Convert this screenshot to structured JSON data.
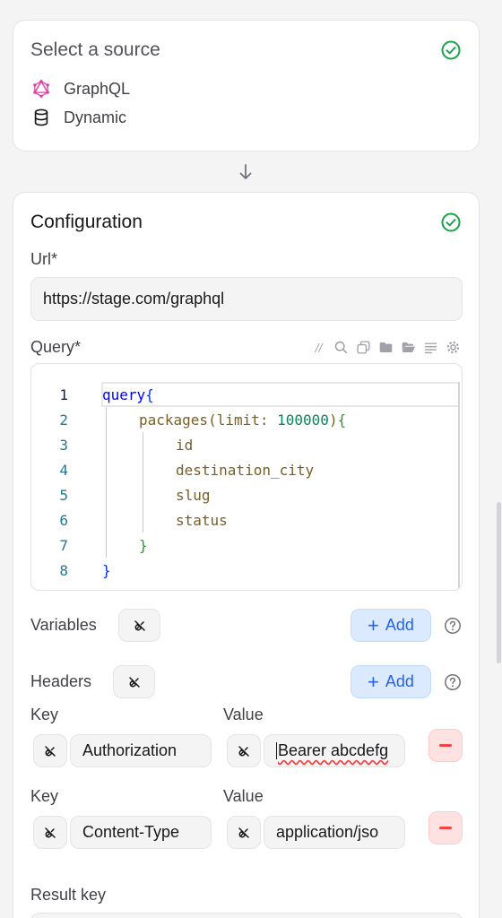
{
  "source_card": {
    "title": "Select a source",
    "options": [
      {
        "icon": "graphql-icon",
        "label": "GraphQL"
      },
      {
        "icon": "database-icon",
        "label": "Dynamic"
      }
    ]
  },
  "configuration": {
    "title": "Configuration",
    "url": {
      "label": "Url",
      "required": "*",
      "value": "https://stage.com/graphql"
    },
    "query": {
      "label": "Query",
      "required": "*",
      "toolbar_icons": [
        "comment-icon",
        "search-icon",
        "copy-icon",
        "folder-icon",
        "folder-open-icon",
        "format-icon",
        "settings-icon"
      ],
      "comment_glyph": "//",
      "lines": [
        {
          "num": "1",
          "parts": [
            "query",
            "{"
          ]
        },
        {
          "num": "2",
          "parts": [
            "packages",
            "(",
            "limit",
            ": ",
            "100000",
            ")",
            "{"
          ]
        },
        {
          "num": "3",
          "parts": [
            "id"
          ]
        },
        {
          "num": "4",
          "parts": [
            "destination_city"
          ]
        },
        {
          "num": "5",
          "parts": [
            "slug"
          ]
        },
        {
          "num": "6",
          "parts": [
            "status"
          ]
        },
        {
          "num": "7",
          "parts": [
            "}"
          ]
        },
        {
          "num": "8",
          "parts": [
            "}"
          ]
        }
      ]
    },
    "variables": {
      "label": "Variables",
      "add_label": "Add"
    },
    "headers": {
      "label": "Headers",
      "add_label": "Add",
      "rows": [
        {
          "key_label": "Key",
          "value_label": "Value",
          "key": "Authorization",
          "value_visible": "Bearer abcdefg"
        },
        {
          "key_label": "Key",
          "value_label": "Value",
          "key": "Content-Type",
          "value_visible": "application/jso"
        }
      ]
    },
    "result_key": {
      "label": "Result key"
    }
  },
  "colors": {
    "check_green": "#16a34a",
    "add_blue": "#2563eb",
    "remove_red": "#ef4444",
    "graphql_pink": "#e535ab"
  }
}
